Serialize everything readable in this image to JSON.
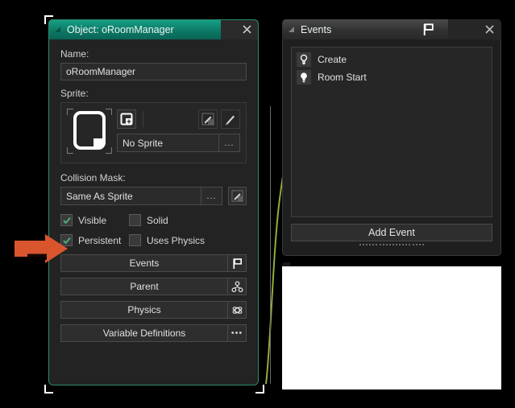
{
  "app": {
    "theme_accent": "#0d7a66",
    "annotation_color": "#d9552e"
  },
  "object_window": {
    "title": "Object: oRoomManager",
    "close_icon": "close-icon",
    "collapse_icon": "collapse-triangle-icon",
    "name_label": "Name:",
    "name_value": "oRoomManager",
    "sprite_label": "Sprite:",
    "sprite_new_icon": "new-sprite-icon",
    "sprite_edit_icon": "edit-sprite-icon",
    "sprite_paint_icon": "paint-brush-icon",
    "sprite_name": "No Sprite",
    "sprite_menu_label": "...",
    "collision_label": "Collision Mask:",
    "collision_value": "Same As Sprite",
    "collision_menu_label": "...",
    "collision_edit_icon": "edit-mask-icon",
    "checkboxes": [
      {
        "label": "Visible",
        "checked": true,
        "name": "visible"
      },
      {
        "label": "Solid",
        "checked": false,
        "name": "solid"
      },
      {
        "label": "Persistent",
        "checked": true,
        "name": "persistent"
      },
      {
        "label": "Uses Physics",
        "checked": false,
        "name": "uses-physics"
      }
    ],
    "buttons": [
      {
        "label": "Events",
        "icon": "flag-icon"
      },
      {
        "label": "Parent",
        "icon": "parent-nodes-icon"
      },
      {
        "label": "Physics",
        "icon": "physics-atom-icon"
      },
      {
        "label": "Variable Definitions",
        "icon": "ellipsis-icon"
      }
    ]
  },
  "events_window": {
    "title": "Events",
    "flag_icon": "flag-icon",
    "close_icon": "close-icon",
    "collapse_icon": "collapse-triangle-icon",
    "events": [
      {
        "label": "Create",
        "icon": "lightbulb-outline-icon"
      },
      {
        "label": "Room Start",
        "icon": "lightbulb-filled-icon"
      }
    ],
    "add_event_label": "Add Event"
  },
  "annotation": {
    "arrow_icon": "arrow-right-annotation",
    "points_at": "persistent-checkbox"
  },
  "blank_panel": {
    "name": "blank-white-panel"
  }
}
